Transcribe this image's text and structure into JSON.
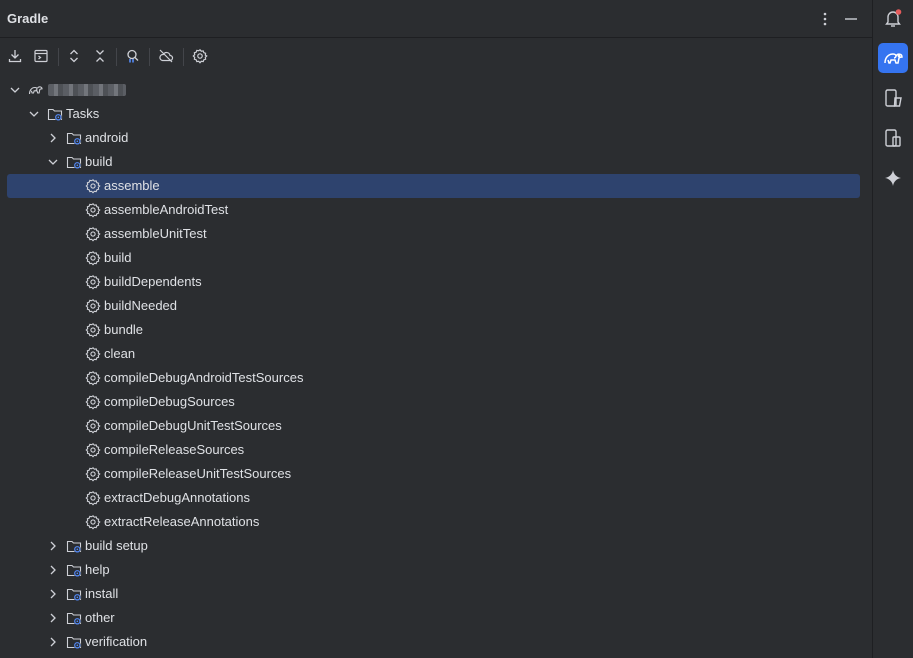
{
  "panel": {
    "title": "Gradle"
  },
  "header_buttons": [
    "more-options-icon",
    "minimize-icon"
  ],
  "toolbar": {
    "buttons": [
      {
        "name": "download-sources-icon"
      },
      {
        "name": "execute-task-icon"
      },
      {
        "name": "expand-all-icon"
      },
      {
        "name": "collapse-all-icon"
      },
      {
        "name": "analyze-dependencies-icon"
      },
      {
        "name": "offline-mode-icon"
      },
      {
        "name": "gradle-settings-icon"
      }
    ]
  },
  "tree": {
    "project_label": "",
    "tasks_label": "Tasks",
    "groups": {
      "android": "android",
      "build": "build",
      "build_setup": "build setup",
      "help": "help",
      "install": "install",
      "other": "other",
      "verification": "verification"
    },
    "build_tasks": [
      "assemble",
      "assembleAndroidTest",
      "assembleUnitTest",
      "build",
      "buildDependents",
      "buildNeeded",
      "bundle",
      "clean",
      "compileDebugAndroidTestSources",
      "compileDebugSources",
      "compileDebugUnitTestSources",
      "compileReleaseSources",
      "compileReleaseUnitTestSources",
      "extractDebugAnnotations",
      "extractReleaseAnnotations"
    ],
    "selected_task": "assemble"
  },
  "right_toolbar": [
    {
      "name": "notifications-icon",
      "active": false,
      "badge": true
    },
    {
      "name": "gradle-elephant-icon",
      "active": true
    },
    {
      "name": "device-explorer-icon",
      "active": false
    },
    {
      "name": "device-manager-icon",
      "active": false
    },
    {
      "name": "ai-assistant-icon",
      "active": false
    }
  ],
  "colors": {
    "background": "#2b2d30",
    "selection": "#2e436e",
    "accent": "#3574f0",
    "text": "#dfe1e5",
    "icon": "#ced0d6",
    "badge": "#e55b5b"
  }
}
